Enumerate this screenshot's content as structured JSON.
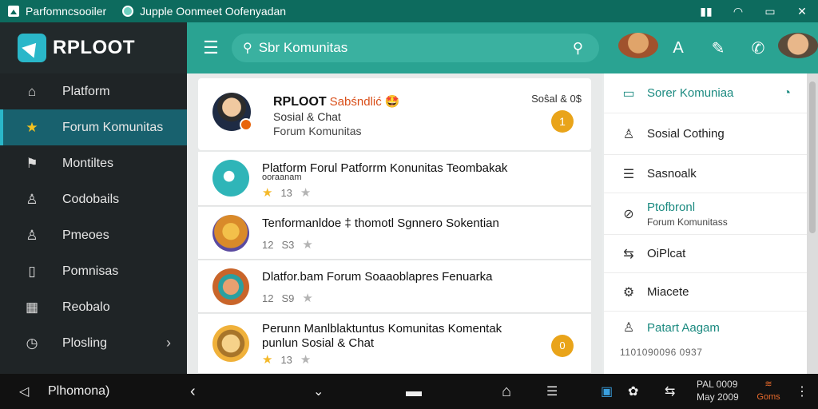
{
  "titlebar": {
    "app_title": "Parfomncsooiler",
    "window_title": "Jupple Oonmeet Oofenyadan",
    "sys_icons": [
      "signal-icon",
      "wifi-icon",
      "battery-icon",
      "close-icon"
    ],
    "sys_glyphs": [
      "▮▮",
      "◠",
      "▭",
      "✕"
    ]
  },
  "sidebar": {
    "brand": "RPLOOT",
    "items": [
      {
        "label": "Platform",
        "icon": "home-icon",
        "glyph": "⌂"
      },
      {
        "label": "Forum Komunitas",
        "icon": "star-icon",
        "glyph": "★",
        "active": true
      },
      {
        "label": "Montiltes",
        "icon": "flag-icon",
        "glyph": "⚑"
      },
      {
        "label": "Codobails",
        "icon": "user-icon",
        "glyph": "♙"
      },
      {
        "label": "Pmeoes",
        "icon": "person-icon",
        "glyph": "♙"
      },
      {
        "label": "Pomnisas",
        "icon": "document-icon",
        "glyph": "▯"
      },
      {
        "label": "Reobalo",
        "icon": "grid-icon",
        "glyph": "▦"
      },
      {
        "label": "Plosling",
        "icon": "clock-icon",
        "glyph": "◷",
        "chevron": "›"
      }
    ]
  },
  "header": {
    "menu_glyph": "☰",
    "search_placeholder": "Sbr Komunitas",
    "search_glyph": "⚲",
    "icons": [
      {
        "name": "search-icon",
        "glyph": "⚲"
      },
      {
        "name": "user-avatar-icon",
        "glyph": ""
      },
      {
        "name": "text-format-icon",
        "glyph": "A"
      },
      {
        "name": "edit-note-icon",
        "glyph": "✎"
      },
      {
        "name": "phone-icon",
        "glyph": "✆"
      },
      {
        "name": "profile-avatar-icon",
        "glyph": ""
      }
    ]
  },
  "featured": {
    "name": "RPLOOT",
    "tag": "Sabśndlić 🤩",
    "line2": "Sosial & Chat",
    "line3": "Forum Komunitas",
    "meta": "Soŝal & 0$",
    "count": "1"
  },
  "posts": [
    {
      "title": "Platform Forul Patforrm Konunitas Teombakak",
      "sub": "ooraanam",
      "stats": [
        "★",
        "13",
        "★"
      ],
      "pic_color": "#2fb5b8"
    },
    {
      "title": "Tenformanldoe ‡ thomotl Sgnnero Sokentian",
      "sub": "",
      "stats": [
        "12",
        "S3",
        "★"
      ],
      "pic_color": "#d98a2a"
    },
    {
      "title": "Dlatfor.bam Forum Soaaoblapres Fenuarka",
      "sub": "",
      "stats": [
        "12",
        "S9",
        "★"
      ],
      "pic_color": "#c9652a"
    },
    {
      "title": "Perunn Manlblaktuntus Komunitas Komentak",
      "sub": "punlun Sosial & Chat",
      "stats": [
        "★",
        "13",
        "★"
      ],
      "pic_color": "#f0b13a",
      "ring": "0"
    }
  ],
  "rpanel": {
    "head": "Sorer Komuniaa",
    "head_icon": "briefcase-icon",
    "items": [
      {
        "label": "Sosial Cothing",
        "icon": "user-icon",
        "glyph": "♙"
      },
      {
        "label": "Sasnoalk",
        "icon": "list-icon",
        "glyph": "☰"
      },
      {
        "label": "Ptofbronl",
        "sub": "Forum Komunitass",
        "icon": "compass-icon",
        "glyph": "⊘",
        "teal": true
      },
      {
        "label": "OiPlcat",
        "icon": "share-icon",
        "glyph": "⇆"
      },
      {
        "label": "Miacete",
        "icon": "settings-icon",
        "glyph": "⚙"
      },
      {
        "label": "Patart Aagam",
        "icon": "person-icon",
        "glyph": "♙",
        "teal": true
      }
    ],
    "foot": "1101090096 0937"
  },
  "taskbar": {
    "left_label": "Plhomona)",
    "clock_top": "PAL 0009",
    "clock_bottom": "May 2009",
    "news": "Goms",
    "icons": [
      "back-icon",
      "nav-back-icon",
      "down-icon",
      "window-icon",
      "home-icon",
      "list-icon",
      "app-icon",
      "settings-icon",
      "share-icon",
      "news-icon",
      "more-icon"
    ],
    "glyphs": [
      "◁",
      "‹",
      "⌄",
      "▬",
      "⌂",
      "☰",
      "▣",
      "✿",
      "⇆",
      "≋",
      "⋮"
    ]
  },
  "colors": {
    "header": "#2aa392",
    "sidebar": "#1f2426",
    "active": "#18616e",
    "accent": "#e9a41a",
    "titlebar": "#0d6b5e"
  }
}
